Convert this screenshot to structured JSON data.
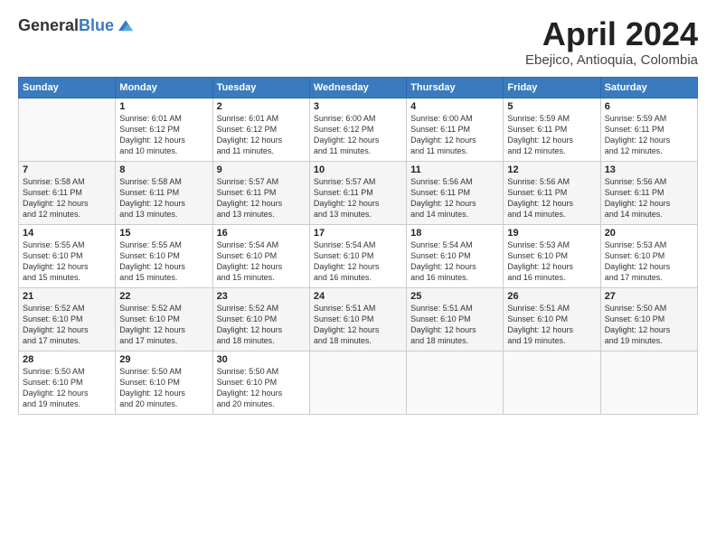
{
  "header": {
    "logo_general": "General",
    "logo_blue": "Blue",
    "month": "April 2024",
    "location": "Ebejico, Antioquia, Colombia"
  },
  "days_of_week": [
    "Sunday",
    "Monday",
    "Tuesday",
    "Wednesday",
    "Thursday",
    "Friday",
    "Saturday"
  ],
  "weeks": [
    [
      {
        "num": "",
        "info": ""
      },
      {
        "num": "1",
        "info": "Sunrise: 6:01 AM\nSunset: 6:12 PM\nDaylight: 12 hours\nand 10 minutes."
      },
      {
        "num": "2",
        "info": "Sunrise: 6:01 AM\nSunset: 6:12 PM\nDaylight: 12 hours\nand 11 minutes."
      },
      {
        "num": "3",
        "info": "Sunrise: 6:00 AM\nSunset: 6:12 PM\nDaylight: 12 hours\nand 11 minutes."
      },
      {
        "num": "4",
        "info": "Sunrise: 6:00 AM\nSunset: 6:11 PM\nDaylight: 12 hours\nand 11 minutes."
      },
      {
        "num": "5",
        "info": "Sunrise: 5:59 AM\nSunset: 6:11 PM\nDaylight: 12 hours\nand 12 minutes."
      },
      {
        "num": "6",
        "info": "Sunrise: 5:59 AM\nSunset: 6:11 PM\nDaylight: 12 hours\nand 12 minutes."
      }
    ],
    [
      {
        "num": "7",
        "info": "Sunrise: 5:58 AM\nSunset: 6:11 PM\nDaylight: 12 hours\nand 12 minutes."
      },
      {
        "num": "8",
        "info": "Sunrise: 5:58 AM\nSunset: 6:11 PM\nDaylight: 12 hours\nand 13 minutes."
      },
      {
        "num": "9",
        "info": "Sunrise: 5:57 AM\nSunset: 6:11 PM\nDaylight: 12 hours\nand 13 minutes."
      },
      {
        "num": "10",
        "info": "Sunrise: 5:57 AM\nSunset: 6:11 PM\nDaylight: 12 hours\nand 13 minutes."
      },
      {
        "num": "11",
        "info": "Sunrise: 5:56 AM\nSunset: 6:11 PM\nDaylight: 12 hours\nand 14 minutes."
      },
      {
        "num": "12",
        "info": "Sunrise: 5:56 AM\nSunset: 6:11 PM\nDaylight: 12 hours\nand 14 minutes."
      },
      {
        "num": "13",
        "info": "Sunrise: 5:56 AM\nSunset: 6:11 PM\nDaylight: 12 hours\nand 14 minutes."
      }
    ],
    [
      {
        "num": "14",
        "info": "Sunrise: 5:55 AM\nSunset: 6:10 PM\nDaylight: 12 hours\nand 15 minutes."
      },
      {
        "num": "15",
        "info": "Sunrise: 5:55 AM\nSunset: 6:10 PM\nDaylight: 12 hours\nand 15 minutes."
      },
      {
        "num": "16",
        "info": "Sunrise: 5:54 AM\nSunset: 6:10 PM\nDaylight: 12 hours\nand 15 minutes."
      },
      {
        "num": "17",
        "info": "Sunrise: 5:54 AM\nSunset: 6:10 PM\nDaylight: 12 hours\nand 16 minutes."
      },
      {
        "num": "18",
        "info": "Sunrise: 5:54 AM\nSunset: 6:10 PM\nDaylight: 12 hours\nand 16 minutes."
      },
      {
        "num": "19",
        "info": "Sunrise: 5:53 AM\nSunset: 6:10 PM\nDaylight: 12 hours\nand 16 minutes."
      },
      {
        "num": "20",
        "info": "Sunrise: 5:53 AM\nSunset: 6:10 PM\nDaylight: 12 hours\nand 17 minutes."
      }
    ],
    [
      {
        "num": "21",
        "info": "Sunrise: 5:52 AM\nSunset: 6:10 PM\nDaylight: 12 hours\nand 17 minutes."
      },
      {
        "num": "22",
        "info": "Sunrise: 5:52 AM\nSunset: 6:10 PM\nDaylight: 12 hours\nand 17 minutes."
      },
      {
        "num": "23",
        "info": "Sunrise: 5:52 AM\nSunset: 6:10 PM\nDaylight: 12 hours\nand 18 minutes."
      },
      {
        "num": "24",
        "info": "Sunrise: 5:51 AM\nSunset: 6:10 PM\nDaylight: 12 hours\nand 18 minutes."
      },
      {
        "num": "25",
        "info": "Sunrise: 5:51 AM\nSunset: 6:10 PM\nDaylight: 12 hours\nand 18 minutes."
      },
      {
        "num": "26",
        "info": "Sunrise: 5:51 AM\nSunset: 6:10 PM\nDaylight: 12 hours\nand 19 minutes."
      },
      {
        "num": "27",
        "info": "Sunrise: 5:50 AM\nSunset: 6:10 PM\nDaylight: 12 hours\nand 19 minutes."
      }
    ],
    [
      {
        "num": "28",
        "info": "Sunrise: 5:50 AM\nSunset: 6:10 PM\nDaylight: 12 hours\nand 19 minutes."
      },
      {
        "num": "29",
        "info": "Sunrise: 5:50 AM\nSunset: 6:10 PM\nDaylight: 12 hours\nand 20 minutes."
      },
      {
        "num": "30",
        "info": "Sunrise: 5:50 AM\nSunset: 6:10 PM\nDaylight: 12 hours\nand 20 minutes."
      },
      {
        "num": "",
        "info": ""
      },
      {
        "num": "",
        "info": ""
      },
      {
        "num": "",
        "info": ""
      },
      {
        "num": "",
        "info": ""
      }
    ]
  ]
}
